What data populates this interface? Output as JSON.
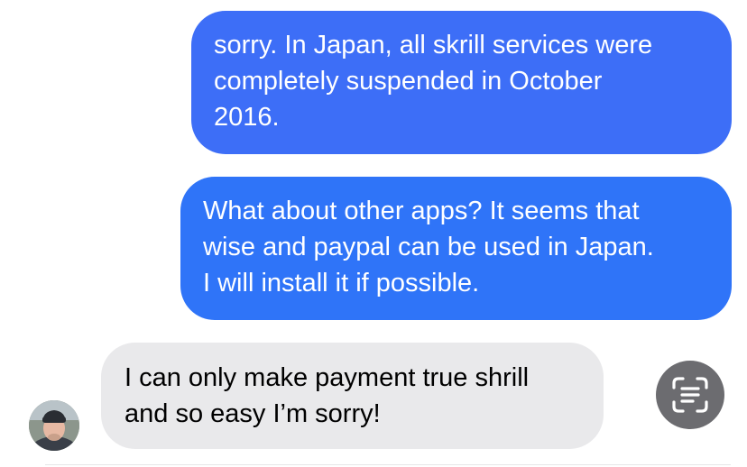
{
  "conversation": {
    "messages": [
      {
        "direction": "outgoing",
        "text": "sorry. In Japan, all skrill services were\ncompletely suspended in October\n2016."
      },
      {
        "direction": "outgoing",
        "text": "What about other apps? It seems that\nwise and paypal can be used in Japan.\nI will install it if possible."
      },
      {
        "direction": "incoming",
        "text": "I can only make payment true shrill\nand so easy I’m sorry!"
      }
    ]
  },
  "icons": {
    "scan_text": "text-scan-icon",
    "avatar": "contact-avatar"
  },
  "colors": {
    "outgoing_bubble": "#3d6ef7",
    "outgoing_bubble_2": "#2f74f8",
    "incoming_bubble": "#e9e9eb",
    "scan_button": "#6c6c70"
  }
}
